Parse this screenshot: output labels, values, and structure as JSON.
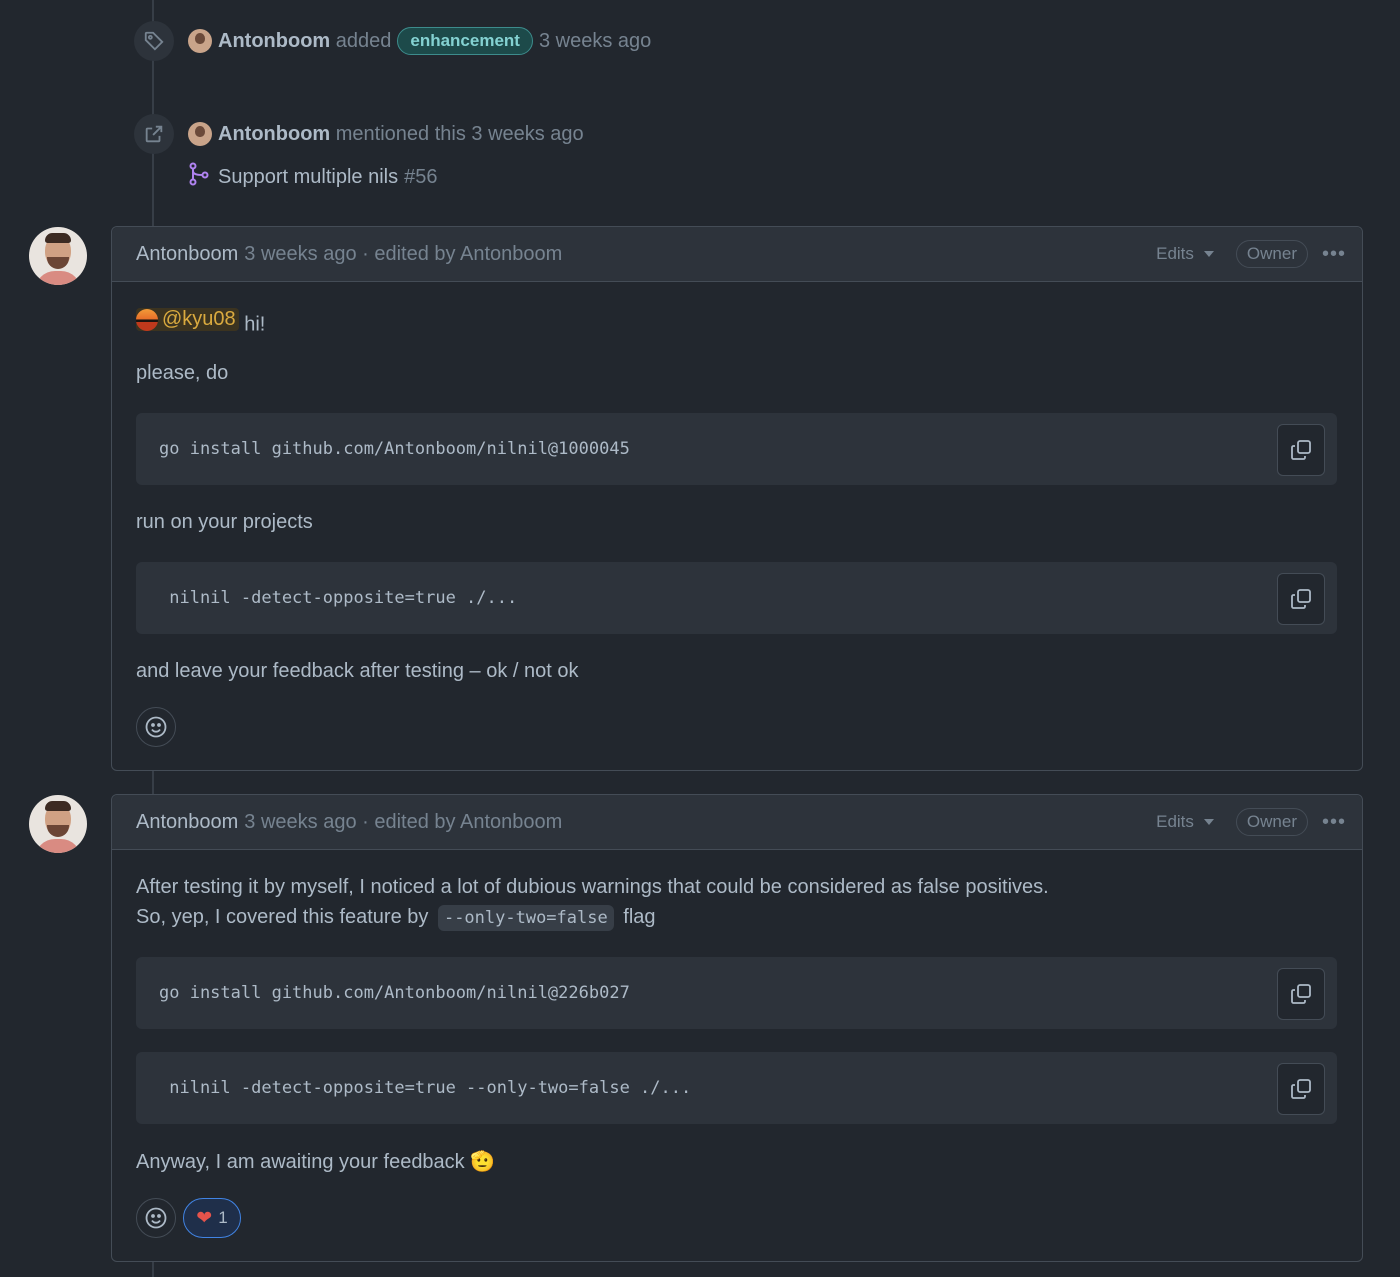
{
  "events": {
    "label_event": {
      "author": "Antonboom",
      "action": "added",
      "label": "enhancement",
      "time": "3 weeks ago",
      "icon": "tag-icon"
    },
    "mention_event": {
      "author": "Antonboom",
      "action": "mentioned this 3 weeks ago",
      "icon": "cross-reference-icon",
      "pr_title": "Support multiple nils",
      "pr_number": "#56",
      "pr_icon": "git-pull-request-icon"
    }
  },
  "comments": [
    {
      "author": "Antonboom",
      "meta": "3 weeks ago · edited by Antonboom",
      "edits_label": "Edits",
      "owner_label": "Owner",
      "mention": "@kyu08",
      "greeting": "hi!",
      "para1": "please, do",
      "code1": "go install github.com/Antonboom/nilnil@1000045",
      "para2": "run on your projects",
      "code2": " nilnil -detect-opposite=true ./...",
      "para3": "and leave your feedback after testing – ok / not ok"
    },
    {
      "author": "Antonboom",
      "meta": "3 weeks ago · edited by Antonboom",
      "edits_label": "Edits",
      "owner_label": "Owner",
      "line1": "After testing it by myself, I noticed a lot of dubious warnings that could be considered as false positives.",
      "line2_pre": "So, yep, I covered this feature by",
      "line2_code": "--only-two=false",
      "line2_post": "flag",
      "code1": "go install github.com/Antonboom/nilnil@226b027",
      "code2": " nilnil -detect-opposite=true --only-two=false ./...",
      "para_end": "Anyway, I am awaiting your feedback 🫡",
      "reaction_emoji": "❤",
      "reaction_count": "1"
    }
  ],
  "colors": {
    "background": "#22272e",
    "label_bg": "#1d4a4a",
    "label_fg": "#84d2d2",
    "mention_fg": "#daaa3f",
    "pr_icon": "#b083f0",
    "reaction_border": "#4184e4"
  }
}
